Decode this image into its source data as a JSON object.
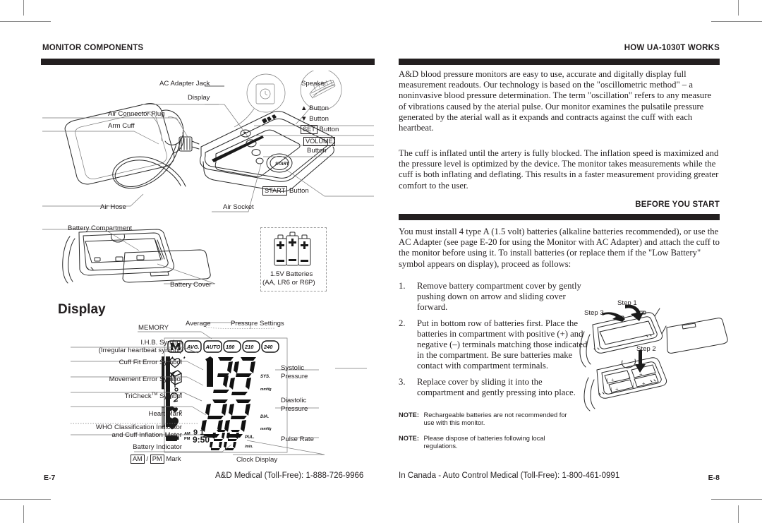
{
  "page": {
    "left_page_number": "E-7",
    "right_page_number": "E-8",
    "left_footer": "A&D Medical (Toll-Free):  1-888-726-9966",
    "right_footer": "In Canada - Auto Control Medical (Toll-Free):  1-800-461-0991"
  },
  "left_column": {
    "heading": "MONITOR COMPONENTS",
    "display_heading": "Display",
    "monitor_labels": {
      "ac_adapter_jack": "AC Adapter Jack",
      "speaker": "Speaker",
      "display": "Display",
      "air_connector_plug": "Air Connector Plug",
      "arm_cuff": "Arm Cuff",
      "air_hose": "Air Hose",
      "air_socket": "Air Socket",
      "up_button": "Button",
      "down_button": "Button",
      "set_button_box": "SET",
      "set_button": "Button",
      "volume_button_box": "VOLUME",
      "volume_button": "Button",
      "start_button_box": "START",
      "start_button": "Button"
    },
    "battery_labels": {
      "battery_compartment": "Battery Compartment",
      "battery_cover": "Battery Cover",
      "battery_note_line1": "1.5V Batteries",
      "battery_note_line2": "(AA, LR6 or R6P)"
    },
    "display_labels": {
      "memory": "MEMORY",
      "average": "Average",
      "pressure_settings": "Pressure Settings",
      "ihb_line1": "I.H.B. Symbol",
      "ihb_line2": "(Irregular heartbeat symbol)",
      "cuff_fit_error": "Cuff Fit Error Symbol",
      "movement_error": "Movement Error Symbol",
      "tricheck": "TriCheck",
      "tricheck_tm": "TM",
      "tricheck_suffix": " Symbol",
      "heart_mark": "Heart Mark",
      "who_line1": "WHO Classification Indicator",
      "who_line2": "and Cuff Inflation Meter",
      "battery_indicator": "Battery Indicator",
      "am_box": "AM",
      "pm_box": "PM",
      "ampm_mark_sep": " / ",
      "ampm_mark_suffix": " Mark",
      "systolic_line1": "Systolic",
      "systolic_line2": "Pressure",
      "diastolic_line1": "Diastolic",
      "diastolic_line2": "Pressure",
      "pulse_rate": "Pulse Rate",
      "clock_display": "Clock Display"
    },
    "lcd": {
      "memory_glyph": "M",
      "avg_pill": "AVG.",
      "auto_pill": "AUTO",
      "pill_180": "180",
      "pill_210": "210",
      "pill_240": "240",
      "systolic_value": "138",
      "systolic_tag": "SYS.",
      "systolic_unit": "mmHg",
      "diastolic_value": "88",
      "diastolic_tag": "DIA.",
      "diastolic_unit": "mmHg",
      "pulse_value": "88",
      "pulse_tag": "PUL.",
      "pulse_unit": "/min.",
      "clock_date": "9  1",
      "clock_time": "9:50",
      "am_label": "AM",
      "pm_label": "PM",
      "tricheck_count": "3"
    }
  },
  "right_column": {
    "heading": "HOW UA-1030T WORKS",
    "paragraph1": "A&D blood pressure monitors are easy to use, accurate and digitally display full measurement readouts. Our technology is based on the \"oscillometric method\" – a noninvasive blood pressure determination. The term \"oscillation\" refers to any measure of vibrations caused by the aterial pulse. Our monitor examines the pulsatile pressure generated by the aterial wall as it expands and contracts against the cuff with each heartbeat.",
    "paragraph2": "The cuff is inflated until the artery is fully blocked. The inflation speed is maximized and the pressure level is optimized by the device. The monitor takes measurements while the cuff is both inflating and deflating. This results in a faster measurement providing greater comfort to the user.",
    "heading2": "BEFORE YOU START",
    "paragraph3": "You must install 4 type A (1.5 volt) batteries (alkaline batteries recommended), or use the AC Adapter (see page E-20 for using the Monitor with AC Adapter) and attach the cuff to the monitor before using it. To install batteries (or replace them if the \"Low Battery\" symbol appears on display), proceed as follows:",
    "steps": [
      {
        "number": "1.",
        "text": "Remove battery compartment cover by gently pushing down on arrow and sliding cover forward."
      },
      {
        "number": "2.",
        "text": "Put in bottom row of batteries first. Place the batteries in compartment with positive (+) and negative (–) terminals matching those indicated in the compartment. Be sure batteries make contact with compartment terminals."
      },
      {
        "number": "3.",
        "text": "Replace cover by sliding it into the compartment and gently pressing into place."
      }
    ],
    "notes": [
      {
        "label": "NOTE:",
        "text": "Rechargeable batteries are not recommended for use with this monitor."
      },
      {
        "label": "NOTE:",
        "text": "Please dispose of batteries following local regulations."
      }
    ],
    "step_diagram": {
      "step1": "Step 1",
      "step2": "Step 2",
      "step3": "Step 3"
    }
  },
  "colors": {
    "ink": "#231f20",
    "rule": "#231f20",
    "line": "#555555",
    "paper": "#ffffff"
  }
}
